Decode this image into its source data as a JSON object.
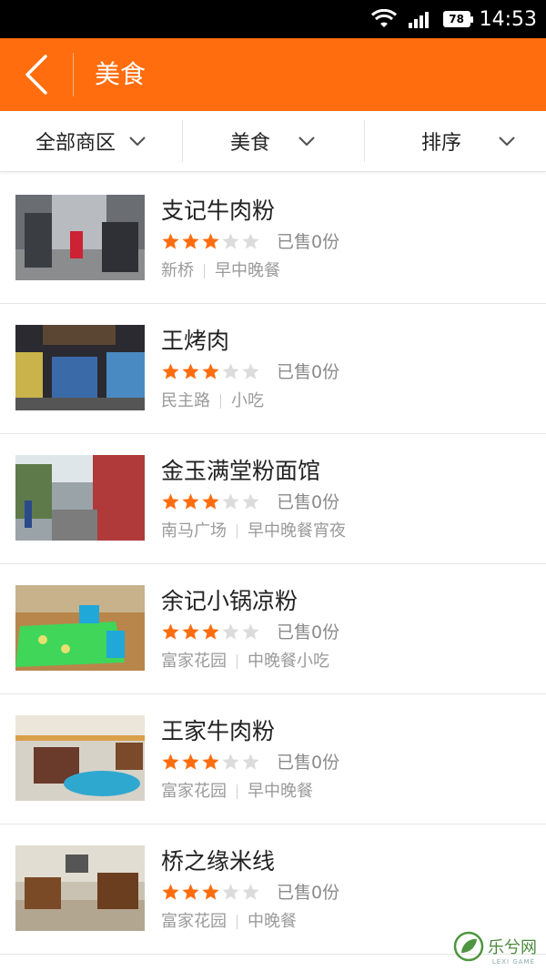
{
  "status_bar": {
    "battery": "78",
    "time": "14:53"
  },
  "header": {
    "title": "美食",
    "back_icon": "chevron-left-icon"
  },
  "filters": [
    {
      "label": "全部商区",
      "icon": "chevron-down-icon"
    },
    {
      "label": "美食",
      "icon": "chevron-down-icon"
    },
    {
      "label": "排序",
      "icon": "chevron-down-icon"
    }
  ],
  "colors": {
    "accent": "#ff6d0e",
    "star_on": "#ff6d0e",
    "star_off": "#dcdcdc"
  },
  "shops": [
    {
      "name": "支记牛肉粉",
      "rating": 3,
      "max_rating": 5,
      "sold": "已售0份",
      "area": "新桥",
      "category": "早中晚餐"
    },
    {
      "name": "王烤肉",
      "rating": 3,
      "max_rating": 5,
      "sold": "已售0份",
      "area": "民主路",
      "category": "小吃"
    },
    {
      "name": "金玉满堂粉面馆",
      "rating": 3,
      "max_rating": 5,
      "sold": "已售0份",
      "area": "南马广场",
      "category": "早中晚餐宵夜"
    },
    {
      "name": "余记小锅凉粉",
      "rating": 3,
      "max_rating": 5,
      "sold": "已售0份",
      "area": "富家花园",
      "category": "中晚餐小吃"
    },
    {
      "name": "王家牛肉粉",
      "rating": 3,
      "max_rating": 5,
      "sold": "已售0份",
      "area": "富家花园",
      "category": "早中晚餐"
    },
    {
      "name": "桥之缘米线",
      "rating": 3,
      "max_rating": 5,
      "sold": "已售0份",
      "area": "富家花园",
      "category": "中晚餐"
    }
  ],
  "watermark": {
    "text": "乐兮网",
    "sub": "LEXI GAME"
  }
}
